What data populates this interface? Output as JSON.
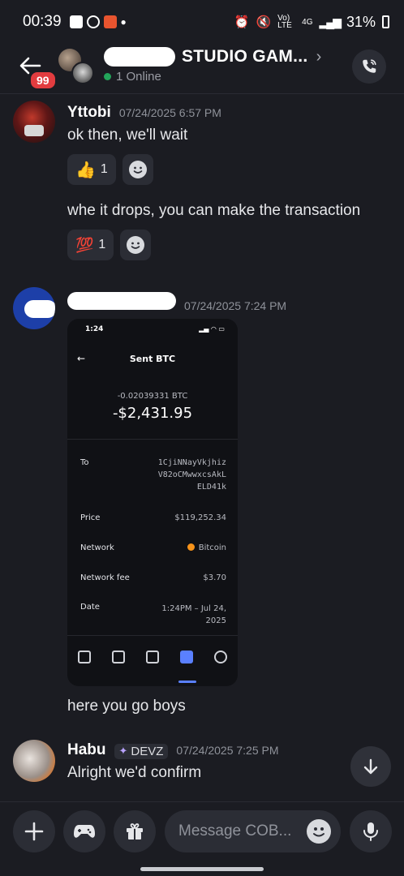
{
  "status_bar": {
    "time": "00:39",
    "network_label": "Vo) LTE",
    "signal_label": "4G",
    "battery": "31%"
  },
  "header": {
    "unread_badge": "99",
    "channel_title": "STUDIO GAM...",
    "online_status": "1 Online"
  },
  "messages": [
    {
      "author": "Yttobi",
      "timestamp": "07/24/2025 6:57 PM",
      "lines": [
        "ok then, we'll wait",
        "whe it drops, you can make the transaction"
      ],
      "reactions": [
        {
          "emoji": "👍",
          "count": "1"
        },
        {
          "emoji": "💯",
          "count": "1"
        }
      ]
    },
    {
      "author": "",
      "timestamp": "07/24/2025 7:24 PM",
      "attachment": {
        "status_time": "1:24",
        "screen_title": "Sent BTC",
        "btc_amount": "-0.02039331 BTC",
        "usd_amount": "-$2,431.95",
        "rows": [
          {
            "label": "To",
            "value": "1CjiNNayVkjhiz\nV82oCMwwxcsAkL\nELD41k"
          },
          {
            "label": "Price",
            "value": "$119,252.34"
          },
          {
            "label": "Network",
            "value": "Bitcoin"
          },
          {
            "label": "Network fee",
            "value": "$3.70"
          },
          {
            "label": "Date",
            "value": "1:24PM – Jul 24,\n2025"
          }
        ]
      },
      "followup": "here you go boys"
    },
    {
      "author": "Habu",
      "role_tag": "DEVZ",
      "timestamp": "07/24/2025 7:25 PM",
      "lines": [
        "Alright we'd confirm"
      ]
    }
  ],
  "composer": {
    "placeholder": "Message COB..."
  }
}
